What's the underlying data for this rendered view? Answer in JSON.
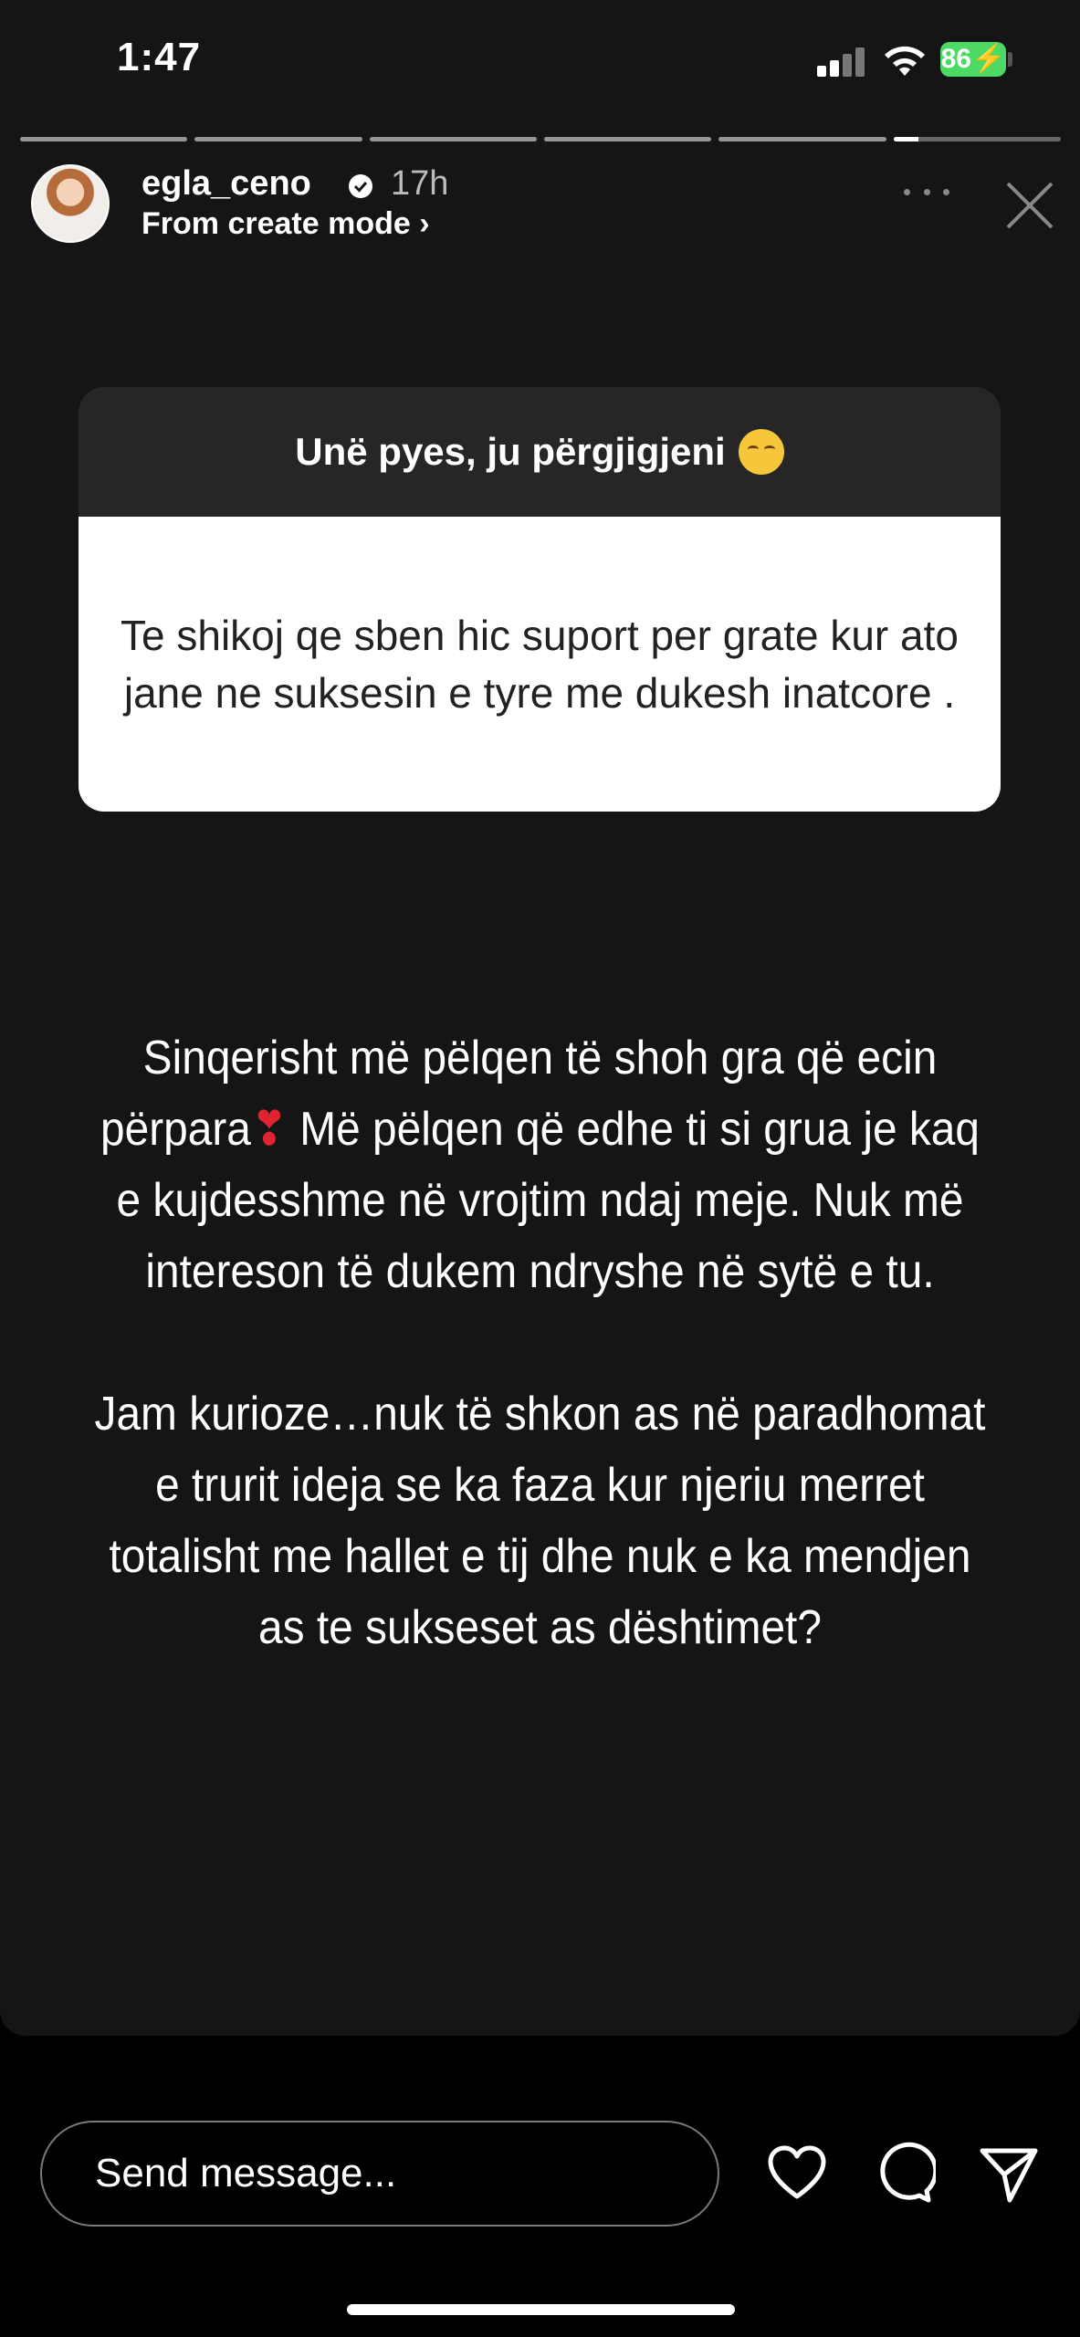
{
  "status_bar": {
    "time": "1:47",
    "battery": "86"
  },
  "story": {
    "segments_total": 6,
    "current_segment": 6,
    "current_progress": 0.15,
    "username": "egla_ceno",
    "time_ago": "17h",
    "subtitle": "From create mode ›"
  },
  "question": {
    "prompt": "Unë pyes, ju përgjigjeni",
    "text": "Te shikoj qe sben hic suport per grate kur ato jane ne suksesin e tyre me dukesh inatcore ."
  },
  "answer": {
    "p1_before_heart": "Sinqerisht më pëlqen të shoh gra që ecin përpara",
    "heart": "❣",
    "p1_after_heart": " Më pëlqen që edhe ti si grua je kaq e kujdesshme në vrojtim ndaj meje. Nuk më intereson të dukem ndryshe në sytë e tu.",
    "p2": "Jam kurioze…nuk të shkon as në paradhomat e trurit ideja se ka faza kur njeriu merret totalisht me hallet e tij dhe nuk e ka mendjen as te sukseset as dështimet?"
  },
  "footer": {
    "message_placeholder": "Send message..."
  },
  "icons": [
    "signal-icon",
    "wifi-icon",
    "battery-icon",
    "verified-icon",
    "more-icon",
    "close-icon",
    "sleepy-emoji-icon",
    "heart-icon",
    "comment-icon",
    "share-icon"
  ]
}
